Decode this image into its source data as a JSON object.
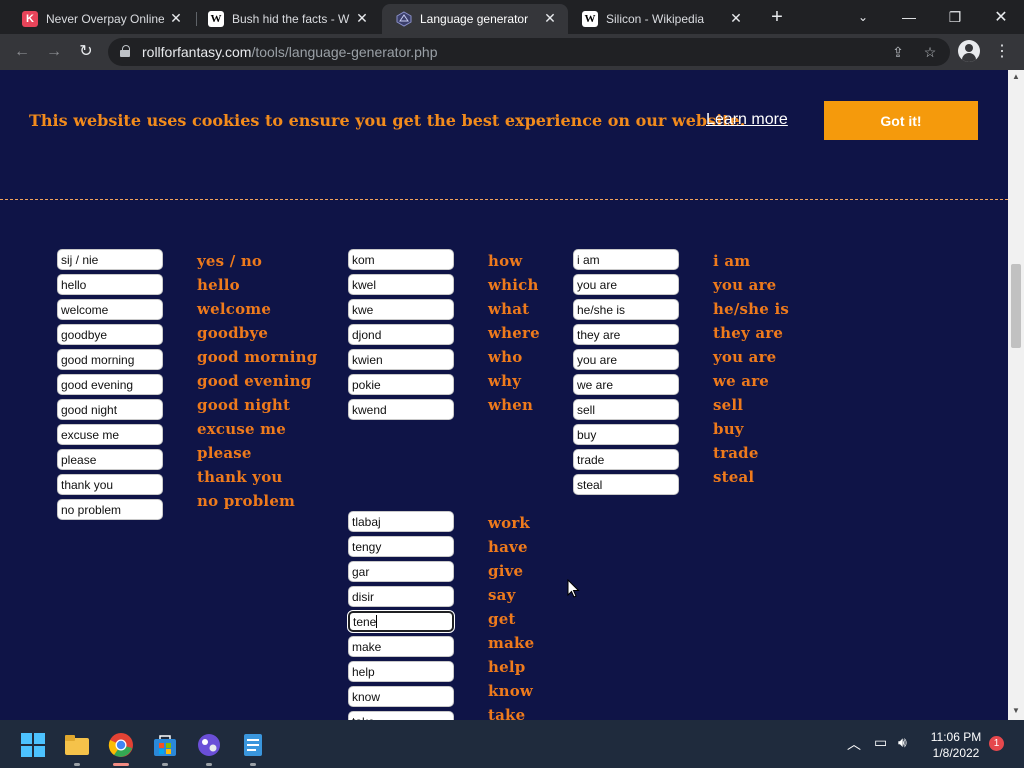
{
  "browser": {
    "tabs": [
      {
        "title": "Never Overpay Online",
        "favicon": "K"
      },
      {
        "title": "Bush hid the facts - Wiki",
        "favicon": "W"
      },
      {
        "title": "Language generator",
        "favicon": "dice"
      },
      {
        "title": "Silicon - Wikipedia",
        "favicon": "W"
      }
    ],
    "url_host": "rollforfantasy.com",
    "url_path": "/tools/language-generator.php"
  },
  "cookie_banner": {
    "message": "This website uses cookies to ensure you get the best experience on our website.",
    "learn_more": "Learn more",
    "button": "Got it!"
  },
  "group1": {
    "fields": [
      "sij / nie",
      "hello",
      "welcome",
      "goodbye",
      "good morning",
      "good evening",
      "good night",
      "excuse me",
      "please",
      "thank you",
      "no problem"
    ],
    "labels": [
      "yes / no",
      "hello",
      "welcome",
      "goodbye",
      "good morning",
      "good evening",
      "good night",
      "excuse me",
      "please",
      "thank you",
      "no problem"
    ]
  },
  "group2": {
    "fields": [
      "kom",
      "kwel",
      "kwe",
      "djond",
      "kwien",
      "pokie",
      "kwend"
    ],
    "labels": [
      "how",
      "which",
      "what",
      "where",
      "who",
      "why",
      "when"
    ]
  },
  "group3": {
    "fields": [
      "i am",
      "you are",
      "he/she is",
      "they are",
      "you are",
      "we are",
      "sell",
      "buy",
      "trade",
      "steal"
    ],
    "labels": [
      "i am",
      "you are",
      "he/she is",
      "they are",
      "you are",
      "we are",
      "sell",
      "buy",
      "trade",
      "steal"
    ]
  },
  "group4": {
    "fields": [
      "tlabaj",
      "tengy",
      "gar",
      "disir",
      "tene",
      "make",
      "help",
      "know",
      "take"
    ],
    "labels": [
      "work",
      "have",
      "give",
      "say",
      "get",
      "make",
      "help",
      "know",
      "take"
    ]
  },
  "taskbar": {
    "time": "11:06 PM",
    "date": "1/8/2022",
    "notifications": "1"
  },
  "colors": {
    "page_bg": "#0f1447",
    "accent_orange": "#f59a0c",
    "label_orange": "#ee7a1c"
  }
}
